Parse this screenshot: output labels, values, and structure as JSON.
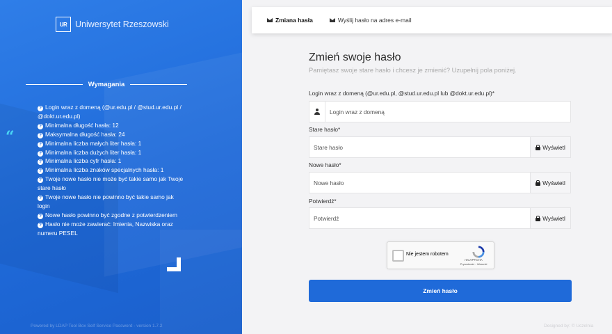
{
  "brand": {
    "name": "Uniwersytet Rzeszowski",
    "mark": "UR"
  },
  "requirements": {
    "title": "Wymagania",
    "items": [
      "Login wraz z domeną (@ur.edu.pl / @stud.ur.edu.pl / @dokt.ur.edu.pl)",
      "Minimalna długość hasła: 12",
      "Maksymalna długość hasła: 24",
      "Minimalna liczba małych liter hasła: 1",
      "Minimalna liczba dużych liter hasła: 1",
      "Minimalna liczba cyfr hasła: 1",
      "Minimalna liczba znaków specjalnych hasła: 1",
      "Twoje nowe hasło nie może być takie samo jak Twoje stare hasło",
      "Twoje nowe hasło nie powinno być takie samo jak login",
      "Nowe hasło powinno być zgodne z potwierdzeniem",
      "Hasło nie może zawierać: Imienia, Nazwiska oraz numeru PESEL"
    ]
  },
  "footer": {
    "left": "Powered by LDAP Tool Box Self Service Password - version 1.7.2",
    "right": "Designed by: © Uczelnia"
  },
  "tabs": [
    {
      "label": "Zmiana hasła"
    },
    {
      "label": "Wyślij hasło na adres e-mail"
    }
  ],
  "form": {
    "title": "Zmień swoje hasło",
    "subtitle": "Pamiętasz swoje stare hasło i chcesz je zmienić? Uzupełnij pola poniżej.",
    "login_label": "Login wraz z domeną (@ur.edu.pl, @stud.ur.edu.pl lub @dokt.ur.edu.pl)*",
    "login_placeholder": "Login wraz z domeną",
    "old_label": "Stare hasło*",
    "old_placeholder": "Stare hasło",
    "new_label": "Nowe hasło*",
    "new_placeholder": "Nowe hasło",
    "confirm_label": "Potwierdź*",
    "confirm_placeholder": "Potwierdź",
    "show_label": "Wyświetl",
    "submit_label": "Zmień hasło"
  },
  "captcha": {
    "label": "Nie jestem robotem",
    "brand": "reCAPTCHA",
    "terms": "Prywatność - Warunki"
  }
}
